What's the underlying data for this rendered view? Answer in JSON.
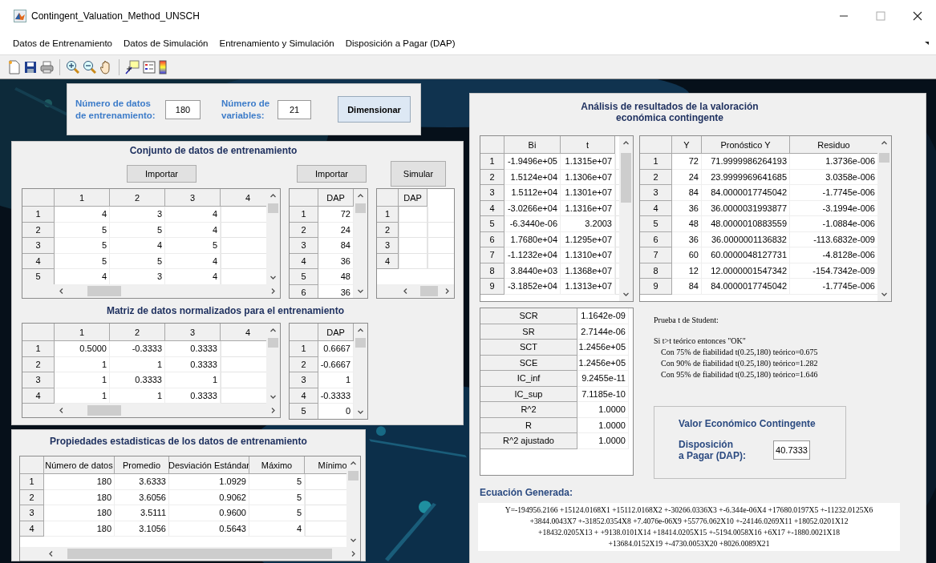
{
  "window": {
    "title": "Contingent_Valuation_Method_UNSCH"
  },
  "menu": [
    {
      "label": "Datos de Entrenamiento"
    },
    {
      "label": "Datos de Simulación"
    },
    {
      "label": "Entrenamiento y Simulación"
    },
    {
      "label": "Disposición a Pagar (DAP)"
    }
  ],
  "dimension_panel": {
    "data_label": "Número de datos\nde entrenamiento:",
    "data_value": "180",
    "variables_label": "Número de\nvariables:",
    "variables_value": "21",
    "button": "Dimensionar"
  },
  "training_panel": {
    "title": "Conjunto de datos de entrenamiento",
    "import_data_button": "Importar",
    "import_simulation_button": "Importar",
    "simulate_button": "Simular",
    "data_table": {
      "columns": [
        "1",
        "2",
        "3",
        "4"
      ],
      "rows": [
        {
          "label": "1",
          "cells": [
            "4",
            "3",
            "4"
          ]
        },
        {
          "label": "2",
          "cells": [
            "5",
            "5",
            "4"
          ]
        },
        {
          "label": "3",
          "cells": [
            "5",
            "4",
            "5"
          ]
        },
        {
          "label": "4",
          "cells": [
            "5",
            "5",
            "4"
          ]
        },
        {
          "label": "5",
          "cells": [
            "4",
            "3",
            "4"
          ]
        }
      ]
    },
    "dap_table": {
      "columns": [
        "DAP"
      ],
      "rows": [
        {
          "label": "1",
          "cells": [
            "72"
          ]
        },
        {
          "label": "2",
          "cells": [
            "24"
          ]
        },
        {
          "label": "3",
          "cells": [
            "84"
          ]
        },
        {
          "label": "4",
          "cells": [
            "36"
          ]
        },
        {
          "label": "5",
          "cells": [
            "48"
          ]
        },
        {
          "label": "6",
          "cells": [
            "36"
          ]
        }
      ]
    },
    "simulation_table": {
      "columns": [
        "DAP"
      ],
      "rows": [
        {
          "label": "1"
        },
        {
          "label": "2"
        },
        {
          "label": "3"
        },
        {
          "label": "4"
        }
      ]
    },
    "normalized_title": "Matriz de datos normalizados para el entrenamiento",
    "normalized_table": {
      "columns": [
        "1",
        "2",
        "3",
        "4"
      ],
      "rows": [
        {
          "label": "1",
          "cells": [
            "0.5000",
            "-0.3333",
            "0.3333"
          ]
        },
        {
          "label": "2",
          "cells": [
            "1",
            "1",
            "0.3333"
          ]
        },
        {
          "label": "3",
          "cells": [
            "1",
            "0.3333",
            "1"
          ]
        },
        {
          "label": "4",
          "cells": [
            "1",
            "1",
            "0.3333"
          ]
        }
      ]
    },
    "normalized_dap_table": {
      "columns": [
        "DAP"
      ],
      "rows": [
        {
          "label": "1",
          "cells": [
            "0.6667"
          ]
        },
        {
          "label": "2",
          "cells": [
            "-0.6667"
          ]
        },
        {
          "label": "3",
          "cells": [
            "1"
          ]
        },
        {
          "label": "4",
          "cells": [
            "-0.3333"
          ]
        },
        {
          "label": "5",
          "cells": [
            "0"
          ]
        }
      ]
    }
  },
  "statistics_panel": {
    "title": "Propiedades estadisticas de los datos de entrenamiento",
    "table": {
      "columns": [
        "Número de datos",
        "Promedio",
        "Desviación Estándar",
        "Máximo",
        "Mínimo"
      ],
      "rows": [
        {
          "label": "1",
          "cells": [
            "180",
            "3.6333",
            "1.0929",
            "5"
          ]
        },
        {
          "label": "2",
          "cells": [
            "180",
            "3.6056",
            "0.9062",
            "5"
          ]
        },
        {
          "label": "3",
          "cells": [
            "180",
            "3.5111",
            "0.9600",
            "5"
          ]
        },
        {
          "label": "4",
          "cells": [
            "180",
            "3.1056",
            "0.5643",
            "4"
          ]
        }
      ]
    }
  },
  "results_panel": {
    "title": "Análisis de resultados de la valoración\neconómica contingente",
    "coefficients_table": {
      "columns": [
        "Bi",
        "t"
      ],
      "rows": [
        {
          "label": "1",
          "cells": [
            "-1.9496e+05",
            "1.1315e+07"
          ]
        },
        {
          "label": "2",
          "cells": [
            "1.5124e+04",
            "1.1306e+07"
          ]
        },
        {
          "label": "3",
          "cells": [
            "1.5112e+04",
            "1.1301e+07"
          ]
        },
        {
          "label": "4",
          "cells": [
            "-3.0266e+04",
            "1.1316e+07"
          ]
        },
        {
          "label": "5",
          "cells": [
            "-6.3440e-06",
            "3.2003"
          ]
        },
        {
          "label": "6",
          "cells": [
            "1.7680e+04",
            "1.1295e+07"
          ]
        },
        {
          "label": "7",
          "cells": [
            "-1.1232e+04",
            "1.1310e+07"
          ]
        },
        {
          "label": "8",
          "cells": [
            "3.8440e+03",
            "1.1368e+07"
          ]
        },
        {
          "label": "9",
          "cells": [
            "-3.1852e+04",
            "1.1313e+07"
          ]
        }
      ]
    },
    "prediction_table": {
      "columns": [
        "Y",
        "Pronóstico Y",
        "Residuo"
      ],
      "rows": [
        {
          "label": "1",
          "cells": [
            "72",
            "71.9999986264193",
            "1.3736e-006"
          ]
        },
        {
          "label": "2",
          "cells": [
            "24",
            "23.9999969641685",
            "3.0358e-006"
          ]
        },
        {
          "label": "3",
          "cells": [
            "84",
            "84.0000017745042",
            "-1.7745e-006"
          ]
        },
        {
          "label": "4",
          "cells": [
            "36",
            "36.0000031993877",
            "-3.1994e-006"
          ]
        },
        {
          "label": "5",
          "cells": [
            "48",
            "48.0000010883559",
            "-1.0884e-006"
          ]
        },
        {
          "label": "6",
          "cells": [
            "36",
            "36.0000001136832",
            "-113.6832e-009"
          ]
        },
        {
          "label": "7",
          "cells": [
            "60",
            "60.0000048127731",
            "-4.8128e-006"
          ]
        },
        {
          "label": "8",
          "cells": [
            "12",
            "12.0000001547342",
            "-154.7342e-009"
          ]
        },
        {
          "label": "9",
          "cells": [
            "84",
            "84.0000017745042",
            "-1.7745e-006"
          ]
        }
      ]
    },
    "summary_table": {
      "rows": [
        {
          "label": "SCR",
          "cells": [
            "1.1642e-09"
          ]
        },
        {
          "label": "SR",
          "cells": [
            "2.7144e-06"
          ]
        },
        {
          "label": "SCT",
          "cells": [
            "1.2456e+05"
          ]
        },
        {
          "label": "SCE",
          "cells": [
            "1.2456e+05"
          ]
        },
        {
          "label": "IC_inf",
          "cells": [
            "9.2455e-11"
          ]
        },
        {
          "label": "IC_sup",
          "cells": [
            "7.1185e-10"
          ]
        },
        {
          "label": "R^2",
          "cells": [
            "1.0000"
          ]
        },
        {
          "label": "R",
          "cells": [
            "1.0000"
          ]
        },
        {
          "label": "R^2 ajustado",
          "cells": [
            "1.0000"
          ]
        }
      ]
    },
    "t_test": {
      "title": "Prueba t de Student:",
      "rule": "Si t>t teórico  entonces \"OK\"",
      "lines": [
        "Con 75% de fiabilidad t(0.25,180) teórico=0.675",
        "Con 90% de fiabilidad t(0.25,180) teórico=1.282",
        "Con 95% de fiabilidad t(0.25,180) teórico=1.646"
      ]
    },
    "value_box": {
      "title": "Valor Económico Contingente",
      "label": "Disposición\na Pagar (DAP):",
      "value": "40.7333"
    },
    "equation_label": "Ecuación Generada:",
    "equation": [
      "Y=-194956.2166 +15124.0168X1 +15112.0168X2 +-30266.0336X3 +-6.344e-06X4 +17680.0197X5 +-11232.0125X6",
      "+3844.0043X7 +-31852.0354X8 +7.4076e-06X9 +55776.062X10 +-24146.0269X11 +18052.0201X12",
      "+18432.0205X13 + +9138.0101X14 +18414.0205X15 +-5194.0058X16 +6X17 +-1880.0021X18",
      "+13684.0152X19 +-4730.0053X20 +8026.0089X21"
    ]
  }
}
